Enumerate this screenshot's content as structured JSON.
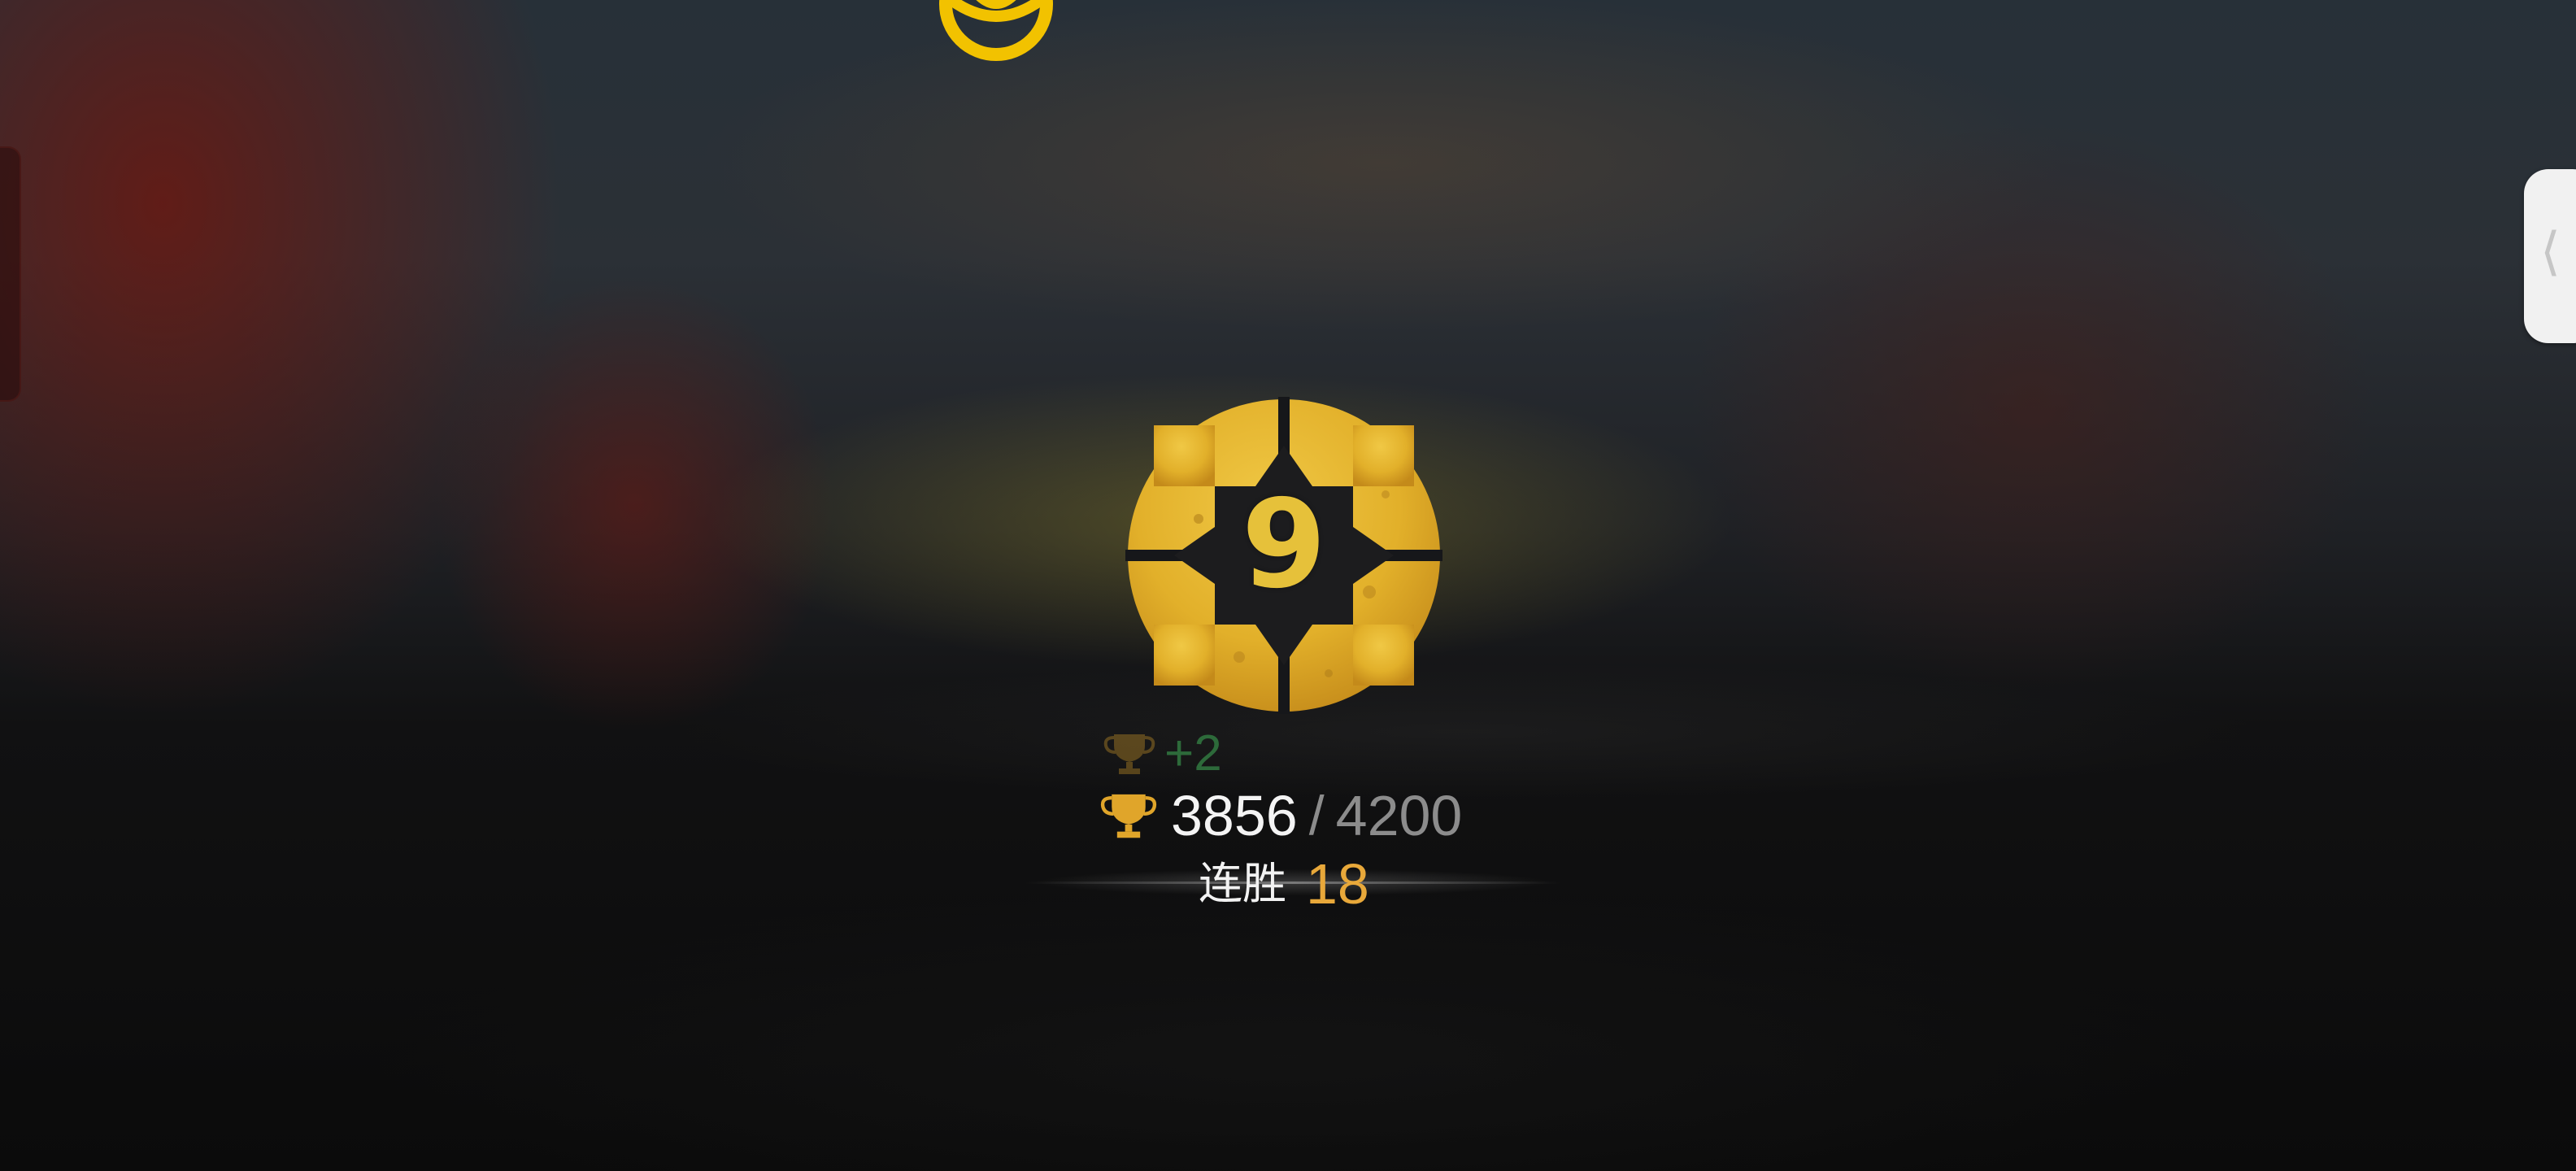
{
  "rank": {
    "level": "9",
    "badge_icon": "rank-badge-icon",
    "badge_color": "#e4b52d"
  },
  "trophy_delta": {
    "text": "+2",
    "color": "#2d6a3a",
    "icon": "trophy-icon"
  },
  "score": {
    "current": "3856",
    "separator": "/",
    "target": "4200",
    "icon": "trophy-icon",
    "current_color": "#f4f4f4",
    "target_color": "#8c8c8c"
  },
  "streak": {
    "label": "连胜",
    "value": "18",
    "value_color": "#e8a83a"
  },
  "side_tab": {
    "glyph": "⟨",
    "icon": "chevron-left-icon"
  },
  "top_emblem": {
    "icon": "emblem-icon",
    "color": "#f2c200"
  }
}
